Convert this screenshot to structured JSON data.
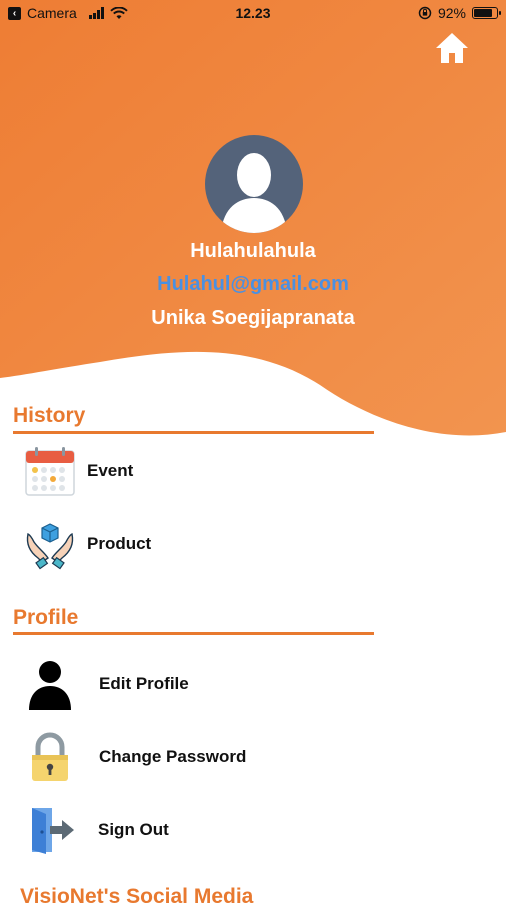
{
  "status_bar": {
    "carrier": "Camera",
    "time": "12.23",
    "battery": "92%",
    "battery_level": 0.92
  },
  "header": {
    "home_icon": "home-icon",
    "avatar_icon": "avatar-placeholder-icon",
    "user_name": "Hulahulahula",
    "user_email": "Hulahul@gmail.com",
    "user_org": "Unika Soegijapranata",
    "colors": {
      "gradient_start": "#ef8039",
      "gradient_end": "#f1924f",
      "email": "#4a90e2"
    }
  },
  "history": {
    "title": "History",
    "items": [
      {
        "label": "Event",
        "icon": "calendar-icon"
      },
      {
        "label": "Product",
        "icon": "hands-box-icon"
      }
    ]
  },
  "profile": {
    "title": "Profile",
    "items": [
      {
        "label": "Edit Profile",
        "icon": "person-icon"
      },
      {
        "label": "Change Password",
        "icon": "lock-icon"
      },
      {
        "label": "Sign Out",
        "icon": "sign-out-icon"
      }
    ]
  },
  "social": {
    "title": "VisioNet's Social Media"
  },
  "accent_color": "#e8792f"
}
